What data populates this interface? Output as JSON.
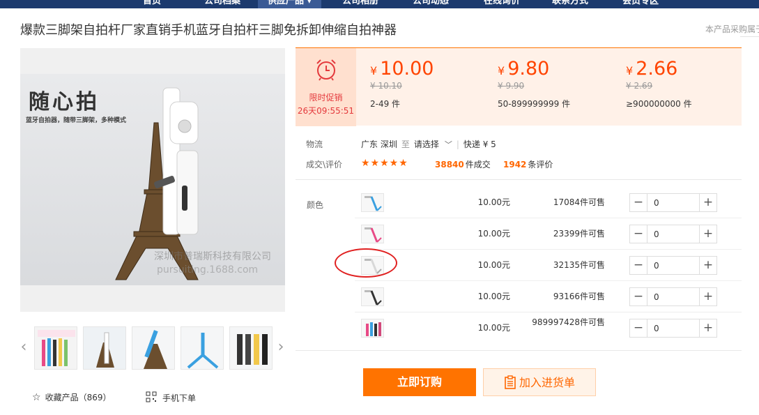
{
  "nav": {
    "items": [
      "首页",
      "公司档案",
      "供应产品",
      "公司相册",
      "公司动态",
      "在线询价",
      "联系方式",
      "会员专区"
    ]
  },
  "title": "爆款三脚架自拍杆厂家直销手机蓝牙自拍杆三脚免拆卸伸缩自拍神器",
  "purchase_note": "本产品采购属于",
  "main_image": {
    "slogan": "随心拍",
    "subslogan": "蓝牙自拍器，随带三脚架，多种模式",
    "watermark_cn": "深圳市普瑞斯科技有限公司",
    "watermark_url": "pursuiting.1688.com"
  },
  "thumbnails": [
    "thumb-1",
    "thumb-2",
    "thumb-3",
    "thumb-4",
    "thumb-5"
  ],
  "favorites": {
    "label": "收藏产品",
    "count": "（869）"
  },
  "mobile_order": "手机下单",
  "promo": {
    "label": "限时促销",
    "timer": "26天09:55:51"
  },
  "tiers": [
    {
      "yen": "¥",
      "price": "10.00",
      "orig": "¥ 10.10",
      "range": "2-49 件"
    },
    {
      "yen": "¥",
      "price": "9.80",
      "orig": "¥ 9.90",
      "range": "50-899999999 件"
    },
    {
      "yen": "¥",
      "price": "2.66",
      "orig": "¥ 2.69",
      "range": "≥900000000 件"
    }
  ],
  "logistics": {
    "label": "物流",
    "origin": "广东 深圳",
    "to": "至",
    "select": "请选择",
    "shipping": "快递 ¥ 5"
  },
  "deals": {
    "label": "成交\\评价",
    "stars": "★★★★★",
    "deal_number": "38840",
    "deal_unit": "件成交",
    "review_number": "1942",
    "review_unit": "条评价"
  },
  "sku": {
    "label": "颜色",
    "rows": [
      {
        "price": "10.00元",
        "stock": "17084件可售",
        "qty": "0",
        "color": "#3aa0e0"
      },
      {
        "price": "10.00元",
        "stock": "23399件可售",
        "qty": "0",
        "color": "#e84a86"
      },
      {
        "price": "10.00元",
        "stock": "32135件可售",
        "qty": "0",
        "color": "#e8e8e8"
      },
      {
        "price": "10.00元",
        "stock": "93166件可售",
        "qty": "0",
        "color": "#333333"
      },
      {
        "price": "10.00元",
        "stock": "989997428件可售",
        "qty": "0",
        "color": "#d24a7c"
      }
    ]
  },
  "buttons": {
    "buy": "立即订购",
    "cart": "加入进货单"
  },
  "colors": {
    "accent": "#ff7300",
    "price": "#ff4400",
    "nav": "#1c3a6e"
  }
}
